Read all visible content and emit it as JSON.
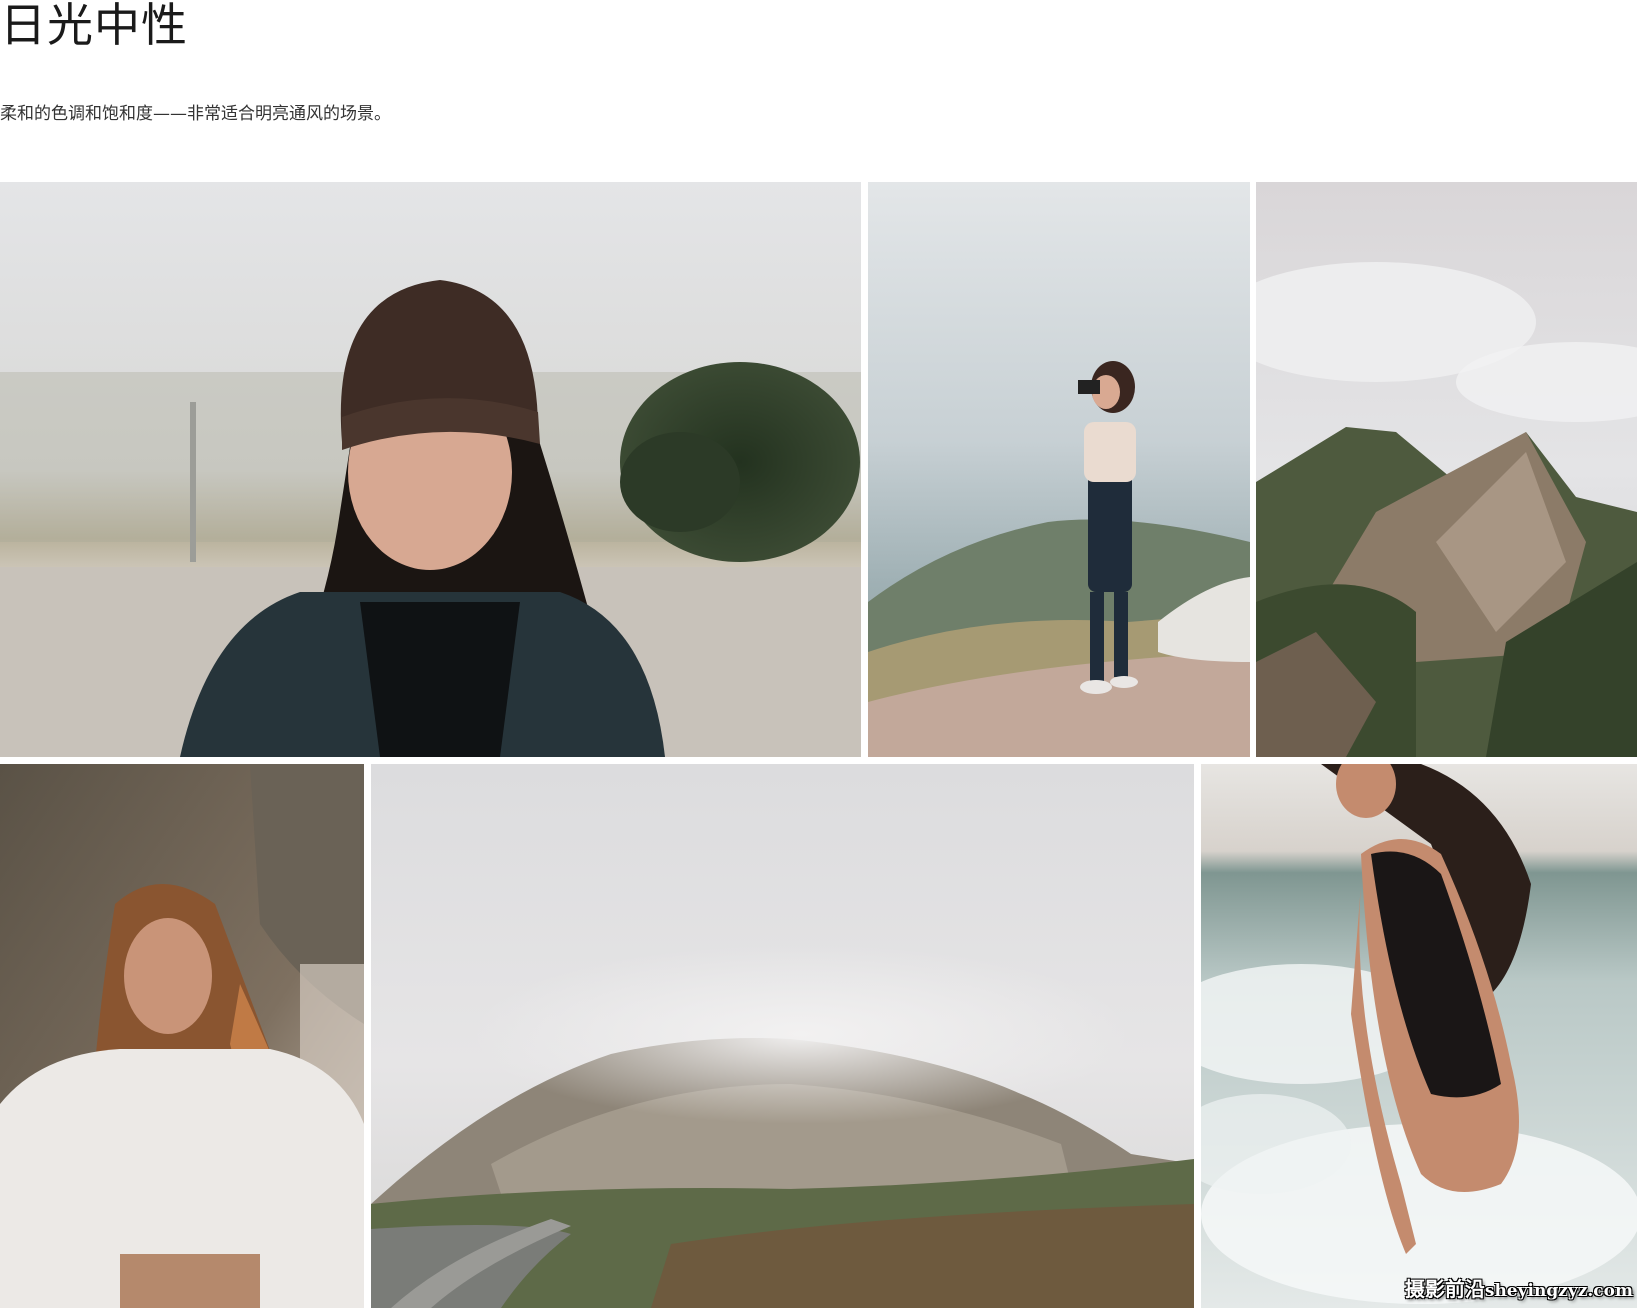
{
  "header": {
    "title": "日光中性",
    "description": "柔和的色调和饱和度——非常适合明亮通风的场景。"
  },
  "gallery": {
    "photos": [
      {
        "name": "portrait-beanie-fog",
        "alt": ""
      },
      {
        "name": "photographer-mountain-overlook",
        "alt": ""
      },
      {
        "name": "misty-mountain-ridge",
        "alt": ""
      },
      {
        "name": "portrait-white-sweater-beach",
        "alt": ""
      },
      {
        "name": "foggy-rock-coastline",
        "alt": ""
      },
      {
        "name": "woman-surf-swimsuit",
        "alt": ""
      }
    ]
  },
  "watermark": {
    "cn": "摄影前沿",
    "latin": "sheyingzyz.com"
  }
}
